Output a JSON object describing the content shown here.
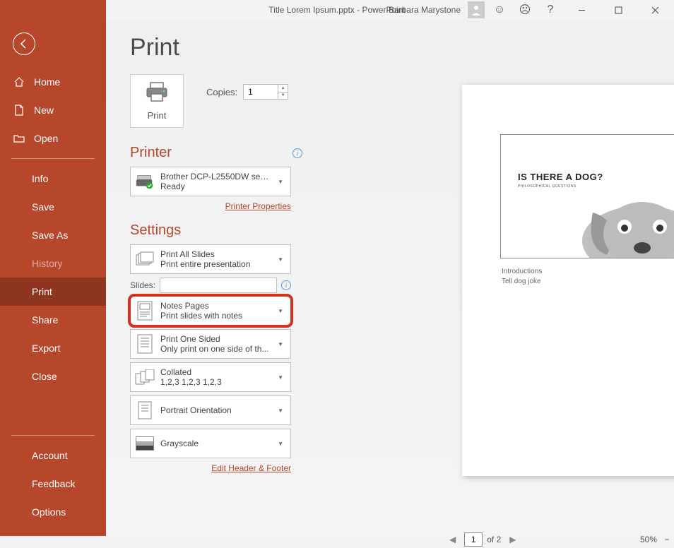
{
  "titlebar": {
    "title": "Title Lorem Ipsum.pptx  -  PowerPoint",
    "user": "Barbara Marystone"
  },
  "sidebar": {
    "nav": [
      {
        "label": "Home"
      },
      {
        "label": "New"
      },
      {
        "label": "Open"
      }
    ],
    "sub": [
      {
        "label": "Info"
      },
      {
        "label": "Save"
      },
      {
        "label": "Save As"
      },
      {
        "label": "History"
      },
      {
        "label": "Print"
      },
      {
        "label": "Share"
      },
      {
        "label": "Export"
      },
      {
        "label": "Close"
      }
    ],
    "bottom": [
      {
        "label": "Account"
      },
      {
        "label": "Feedback"
      },
      {
        "label": "Options"
      }
    ]
  },
  "page_title": "Print",
  "print_button": "Print",
  "copies": {
    "label": "Copies:",
    "value": "1"
  },
  "printer": {
    "heading": "Printer",
    "name": "Brother DCP-L2550DW serie...",
    "status": "Ready",
    "properties_link": "Printer Properties"
  },
  "settings": {
    "heading": "Settings",
    "slides_label": "Slides:",
    "items": [
      {
        "title": "Print All Slides",
        "sub": "Print entire presentation"
      },
      {
        "title": "Notes Pages",
        "sub": "Print slides with notes"
      },
      {
        "title": "Print One Sided",
        "sub": "Only print on one side of th..."
      },
      {
        "title": "Collated",
        "sub": "1,2,3     1,2,3     1,2,3"
      },
      {
        "title": "Portrait Orientation",
        "sub": ""
      },
      {
        "title": "Grayscale",
        "sub": ""
      }
    ],
    "edit_header_link": "Edit Header & Footer"
  },
  "preview": {
    "slide_title": "IS THERE A DOG?",
    "slide_sub": "PHILOSOPHICAL QUESTIONS",
    "notes_line1": "Introductions",
    "notes_line2": "Tell dog joke",
    "page_number": "1"
  },
  "footer": {
    "current_page": "1",
    "of_text": "of 2",
    "zoom": "50%"
  }
}
